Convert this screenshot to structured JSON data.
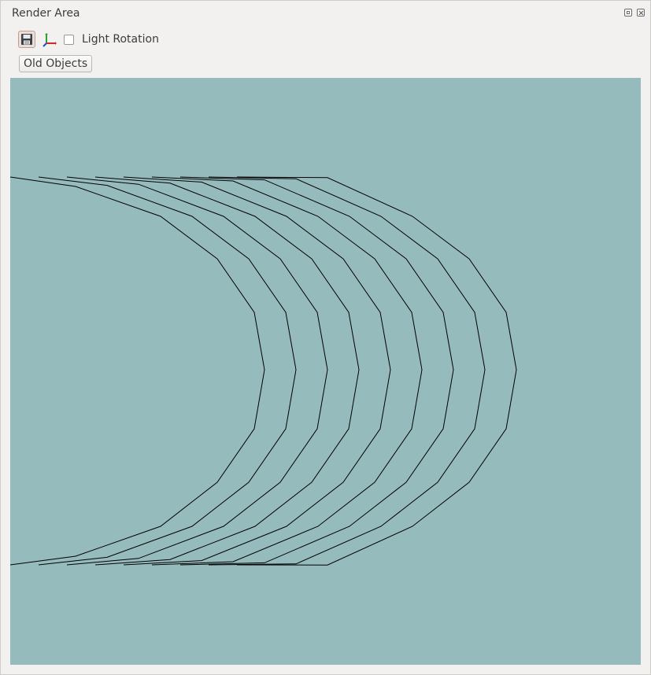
{
  "window": {
    "title": "Render Area",
    "controls": [
      "float-icon",
      "close-icon"
    ]
  },
  "toolbar": {
    "save_icon": "save-icon",
    "axes_icon": "axes-icon",
    "light_rotation_label": "Light Rotation",
    "light_rotation_checked": false
  },
  "old_objects_label": "Old Objects",
  "render": {
    "background": "#96bbbc",
    "line_color": "#000000",
    "curve_count": 9
  }
}
